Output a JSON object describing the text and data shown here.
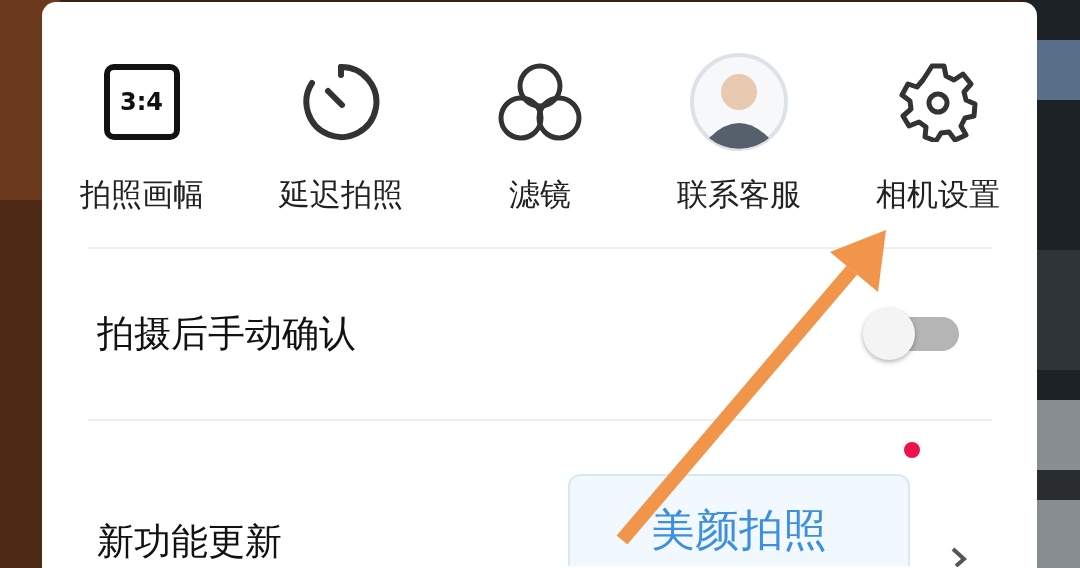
{
  "menu_items": [
    {
      "kind": "ratio",
      "icon_text": "3:4",
      "label": "拍照画幅"
    },
    {
      "kind": "timer",
      "label": "延迟拍照"
    },
    {
      "kind": "filter",
      "label": "滤镜"
    },
    {
      "kind": "avatar",
      "label": "联系客服"
    },
    {
      "kind": "gear",
      "label": "相机设置"
    }
  ],
  "settings": [
    {
      "kind": "toggle",
      "label": "拍摄后手动确认",
      "on": false
    },
    {
      "kind": "link",
      "label": "新功能更新",
      "new_dot": true,
      "button": "美颜拍照"
    }
  ]
}
